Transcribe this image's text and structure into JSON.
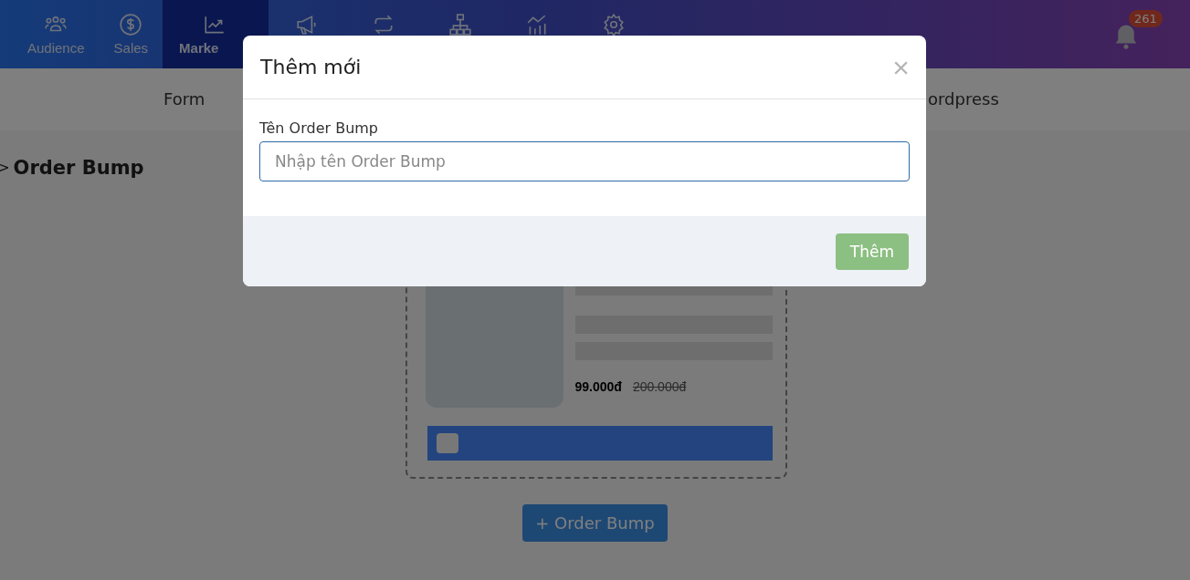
{
  "nav": {
    "items": [
      {
        "label": "Audience",
        "selected": false
      },
      {
        "label": "Sales",
        "selected": false
      },
      {
        "label": "Marke",
        "selected": true
      },
      {
        "selected": false
      },
      {
        "selected": false
      },
      {
        "selected": false
      },
      {
        "selected": false
      },
      {
        "selected": false
      }
    ],
    "badge": "261"
  },
  "subnav": {
    "items": [
      "Form",
      "ordpress"
    ]
  },
  "page": {
    "breadcrumb": ">",
    "title": "Order Bump"
  },
  "preview": {
    "price": "99.000đ",
    "old_price": "200.000đ",
    "checked": false
  },
  "add_button": "+ Order Bump",
  "modal": {
    "title": "Thêm mới",
    "close": "×",
    "field": {
      "label": "Tên Order Bump",
      "placeholder": "Nhập tên Order Bump"
    },
    "submit": "Thêm"
  }
}
